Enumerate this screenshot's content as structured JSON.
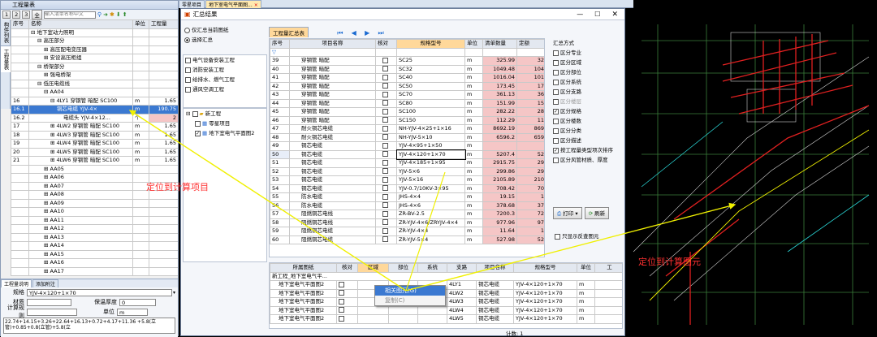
{
  "top_tabs": [
    "零星项目",
    "地下室电气平面图..."
  ],
  "left": {
    "title": "工程量表",
    "levels": [
      "1",
      "2",
      "3",
      "全"
    ],
    "search_placeholder": "输入清单名称中文",
    "headers": [
      "序号",
      "名称",
      "单位",
      "工程量"
    ],
    "rows": [
      {
        "no": "",
        "name": "⊟ 地下室动力照明",
        "unit": "",
        "qty": "",
        "indent": 0
      },
      {
        "no": "",
        "name": "⊟ 高压部分",
        "unit": "",
        "qty": "",
        "indent": 1
      },
      {
        "no": "",
        "name": "⊞ 高压配电变压器",
        "unit": "",
        "qty": "",
        "indent": 2
      },
      {
        "no": "",
        "name": "⊞ 安设高压柜组",
        "unit": "",
        "qty": "",
        "indent": 2
      },
      {
        "no": "",
        "name": "⊟ 桥架部分",
        "unit": "",
        "qty": "",
        "indent": 1
      },
      {
        "no": "",
        "name": "⊞ 强电桥架",
        "unit": "",
        "qty": "",
        "indent": 2
      },
      {
        "no": "",
        "name": "⊟ 低压电缆线",
        "unit": "",
        "qty": "",
        "indent": 1
      },
      {
        "no": "",
        "name": "⊟ AA04",
        "unit": "",
        "qty": "",
        "indent": 2
      },
      {
        "no": "16",
        "name": "⊟ 4LY1 穿钢管 暗配 SC100",
        "unit": "m",
        "qty": "1.65",
        "indent": 3
      },
      {
        "no": "16.1",
        "name": "铜芯电缆 YJV-4×",
        "unit": "m",
        "qty": "190.75",
        "indent": 4,
        "sel": true
      },
      {
        "no": "16.2",
        "name": "电缆头 YJV-4×12...",
        "unit": "个",
        "qty": "2",
        "indent": 5,
        "pink": true
      },
      {
        "no": "17",
        "name": "⊞ 4LW2 穿钢管 暗配 SC100",
        "unit": "m",
        "qty": "1.65",
        "indent": 3
      },
      {
        "no": "18",
        "name": "⊞ 4LW3 穿钢管 暗配 SC100",
        "unit": "m",
        "qty": "1.65",
        "indent": 3
      },
      {
        "no": "19",
        "name": "⊞ 4LW4 穿钢管 暗配 SC100",
        "unit": "m",
        "qty": "1.65",
        "indent": 3
      },
      {
        "no": "20",
        "name": "⊞ 4LW5 穿钢管 暗配 SC100",
        "unit": "m",
        "qty": "1.65",
        "indent": 3
      },
      {
        "no": "21",
        "name": "⊞ 4LW6 穿钢管 暗配 SC100",
        "unit": "m",
        "qty": "1.65",
        "indent": 3
      },
      {
        "no": "",
        "name": "⊞ AA05",
        "unit": "",
        "qty": "",
        "indent": 2
      },
      {
        "no": "",
        "name": "⊞ AA06",
        "unit": "",
        "qty": "",
        "indent": 2
      },
      {
        "no": "",
        "name": "⊞ AA07",
        "unit": "",
        "qty": "",
        "indent": 2
      },
      {
        "no": "",
        "name": "⊞ AA08",
        "unit": "",
        "qty": "",
        "indent": 2
      },
      {
        "no": "",
        "name": "⊞ AA09",
        "unit": "",
        "qty": "",
        "indent": 2
      },
      {
        "no": "",
        "name": "⊞ AA10",
        "unit": "",
        "qty": "",
        "indent": 2
      },
      {
        "no": "",
        "name": "⊞ AA11",
        "unit": "",
        "qty": "",
        "indent": 2
      },
      {
        "no": "",
        "name": "⊞ AA12",
        "unit": "",
        "qty": "",
        "indent": 2
      },
      {
        "no": "",
        "name": "⊞ AA13",
        "unit": "",
        "qty": "",
        "indent": 2
      },
      {
        "no": "",
        "name": "⊞ AA14",
        "unit": "",
        "qty": "",
        "indent": 2
      },
      {
        "no": "",
        "name": "⊞ AA15",
        "unit": "",
        "qty": "",
        "indent": 2
      },
      {
        "no": "",
        "name": "⊞ AA16",
        "unit": "",
        "qty": "",
        "indent": 2
      },
      {
        "no": "",
        "name": "⊞ AA17",
        "unit": "",
        "qty": "",
        "indent": 2
      },
      {
        "no": "",
        "name": "⊞ AA18",
        "unit": "",
        "qty": "",
        "indent": 2
      }
    ],
    "side_tabs": [
      "构件列表",
      "工程量表"
    ],
    "props_tabs": [
      "工程量说明",
      "添加附注"
    ],
    "props": {
      "spec_label": "规格",
      "spec_value": "YJV-4×120+1×70",
      "material_label": "材质",
      "thickness_label": "保温厚度",
      "thickness_value": "0",
      "formula_label": "计算规则",
      "unit_label": "单位",
      "unit_value": "m",
      "formula_text": "22.74+14.15+3.26+22.64+16.13+0.72+4.17+11.36 +5.8(立管)+0.85+0.8(立管)+5.8(立"
    }
  },
  "dialog": {
    "title": "汇总结果",
    "radio_current": "仅汇总当前图纸",
    "radio_selected": "选择汇总",
    "categories": [
      {
        "label": "电气设备安装工程",
        "checked": false
      },
      {
        "label": "消防安装工程",
        "checked": false
      },
      {
        "label": "给排水、燃气工程",
        "checked": false
      },
      {
        "label": "通风空调工程",
        "checked": false
      }
    ],
    "tree_root": "新工程",
    "tree_items": [
      {
        "label": "零星项目",
        "checked": false
      },
      {
        "label": "地下室电气平面图2",
        "checked": true
      }
    ],
    "main_tabs": [
      "工程量汇总表"
    ],
    "table_headers": [
      "序号",
      "项目名称",
      "核对",
      "规格型号",
      "单位",
      "清单数量",
      "定额"
    ],
    "rows": [
      {
        "no": "39",
        "name": "穿钢管 暗配",
        "spec": "SC25",
        "unit": "m",
        "qty": "325.99",
        "d": "32"
      },
      {
        "no": "40",
        "name": "穿钢管 暗配",
        "spec": "SC32",
        "unit": "m",
        "qty": "1049.48",
        "d": "104"
      },
      {
        "no": "41",
        "name": "穿钢管 暗配",
        "spec": "SC40",
        "unit": "m",
        "qty": "1016.04",
        "d": "101"
      },
      {
        "no": "42",
        "name": "穿钢管 暗配",
        "spec": "SC50",
        "unit": "m",
        "qty": "173.45",
        "d": "17"
      },
      {
        "no": "43",
        "name": "穿钢管 暗配",
        "spec": "SC70",
        "unit": "m",
        "qty": "361.13",
        "d": "36"
      },
      {
        "no": "44",
        "name": "穿钢管 暗配",
        "spec": "SC80",
        "unit": "m",
        "qty": "151.99",
        "d": "15"
      },
      {
        "no": "45",
        "name": "穿钢管 暗配",
        "spec": "SC100",
        "unit": "m",
        "qty": "282.22",
        "d": "28"
      },
      {
        "no": "46",
        "name": "穿钢管 暗配",
        "spec": "SC150",
        "unit": "m",
        "qty": "112.29",
        "d": "11"
      },
      {
        "no": "47",
        "name": "耐火铜芯电缆",
        "spec": "NH-YJV-4×25+1×16",
        "unit": "m",
        "qty": "8692.19",
        "d": "869"
      },
      {
        "no": "48",
        "name": "耐火铜芯电缆",
        "spec": "NH-YJV-5×10",
        "unit": "m",
        "qty": "6596.2",
        "d": "659"
      },
      {
        "no": "49",
        "name": "铜芯电缆",
        "spec": "YJV-4×95+1×50",
        "unit": "m",
        "qty": "",
        "d": ""
      },
      {
        "no": "50",
        "name": "铜芯电缆",
        "spec": "YJV-4×120+1×70",
        "unit": "m",
        "qty": "5207.4",
        "d": "52",
        "sel": true
      },
      {
        "no": "51",
        "name": "铜芯电缆",
        "spec": "YJV-4×185+1×95",
        "unit": "m",
        "qty": "2915.75",
        "d": "29"
      },
      {
        "no": "52",
        "name": "铜芯电缆",
        "spec": "YJV-5×6",
        "unit": "m",
        "qty": "299.86",
        "d": "29"
      },
      {
        "no": "53",
        "name": "铜芯电缆",
        "spec": "YJV-5×16",
        "unit": "m",
        "qty": "2105.89",
        "d": "210"
      },
      {
        "no": "54",
        "name": "铜芯电缆",
        "spec": "YJV-0.7/10KV-3×95",
        "unit": "m",
        "qty": "708.42",
        "d": "70"
      },
      {
        "no": "55",
        "name": "防水电缆",
        "spec": "JHS-4×4",
        "unit": "m",
        "qty": "19.15",
        "d": "1"
      },
      {
        "no": "56",
        "name": "防水电缆",
        "spec": "JHS-4×6",
        "unit": "m",
        "qty": "378.68",
        "d": "37"
      },
      {
        "no": "57",
        "name": "阻燃铜芯电线",
        "spec": "ZR-BV-2.5",
        "unit": "m",
        "qty": "7200.3",
        "d": "72"
      },
      {
        "no": "58",
        "name": "阻燃铜芯电线",
        "spec": "ZR-YJV-4×6/ZRYJV-4×4",
        "unit": "m",
        "qty": "977.96",
        "d": "97"
      },
      {
        "no": "59",
        "name": "阻燃铜芯电缆",
        "spec": "ZR-YJV-4×4",
        "unit": "m",
        "qty": "11.64",
        "d": "1"
      },
      {
        "no": "60",
        "name": "阻燃铜芯电缆",
        "spec": "ZR-YJV-5×4",
        "unit": "m",
        "qty": "527.98",
        "d": "52"
      }
    ],
    "options_title": "汇总方式",
    "options": [
      {
        "label": "区分专业",
        "checked": false
      },
      {
        "label": "区分区域",
        "checked": false
      },
      {
        "label": "区分部位",
        "checked": false
      },
      {
        "label": "区分系统",
        "checked": false
      },
      {
        "label": "区分支路",
        "checked": false
      },
      {
        "label": "区分楼层",
        "checked": false,
        "disabled": true
      },
      {
        "label": "区分规格",
        "checked": true
      },
      {
        "label": "区分楼数",
        "checked": false
      },
      {
        "label": "区分分类",
        "checked": false
      },
      {
        "label": "区分描述",
        "checked": false
      },
      {
        "label": "按工程量类型项次排序",
        "checked": true
      },
      {
        "label": "区分风管材质、厚度",
        "checked": false
      }
    ],
    "print_label": "打印",
    "refresh_label": "刷新",
    "only_show_label": "只显示反查图元",
    "detail_headers": [
      "所属图纸",
      "核对",
      "区域",
      "部位",
      "系统",
      "支路",
      "项目名称",
      "规格型号",
      "单位",
      "工"
    ],
    "detail_root": "新工程_地下室电气平...",
    "detail_rows": [
      {
        "drawing": "地下室电气平面图2",
        "name": "铜芯电缆",
        "spec": "YJV-4×120+1×70",
        "unit": "m",
        "branch": "4LY1"
      },
      {
        "drawing": "地下室电气平面图2",
        "name": "铜芯电缆",
        "spec": "YJV-4×120+1×70",
        "unit": "m",
        "branch": "4LW2"
      },
      {
        "drawing": "地下室电气平面图2",
        "name": "铜芯电缆",
        "spec": "YJV-4×120+1×70",
        "unit": "m",
        "branch": "4LW3"
      },
      {
        "drawing": "地下室电气平面图2",
        "name": "铜芯电缆",
        "spec": "YJV-4×120+1×70",
        "unit": "m",
        "branch": "4LW4"
      },
      {
        "drawing": "地下室电气平面图2",
        "name": "铜芯电缆",
        "spec": "YJV-4×120+1×70",
        "unit": "m",
        "branch": "4LW5"
      }
    ],
    "context_menu": [
      "相关图元(G)",
      "复制(C)"
    ],
    "status": "计数: 1"
  },
  "annotations": {
    "left": "定位到计算项目",
    "right": "定位到计算图元"
  },
  "colors": {
    "accent": "#3b79d1",
    "pink": "#f5c6c6",
    "annotation": "#ff3030",
    "cad_bg": "#000000",
    "arrow": "#f0f000"
  }
}
